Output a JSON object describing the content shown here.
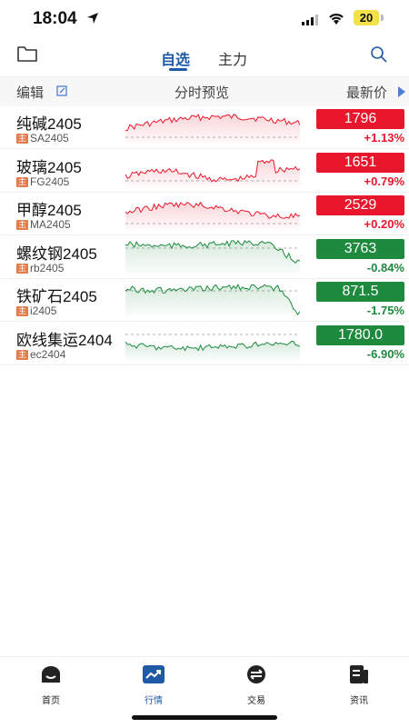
{
  "status": {
    "time": "18:04",
    "battery": "20"
  },
  "tabs": [
    {
      "label": "自选"
    },
    {
      "label": "主力"
    }
  ],
  "header": {
    "edit": "编辑",
    "preview": "分时预览",
    "latest": "最新价"
  },
  "rows": [
    {
      "name": "纯碱2405",
      "badge": "主",
      "code": "SA2405",
      "price": "1796",
      "change": "+1.13%",
      "trend": "up"
    },
    {
      "name": "玻璃2405",
      "badge": "主",
      "code": "FG2405",
      "price": "1651",
      "change": "+0.79%",
      "trend": "up"
    },
    {
      "name": "甲醇2405",
      "badge": "主",
      "code": "MA2405",
      "price": "2529",
      "change": "+0.20%",
      "trend": "up"
    },
    {
      "name": "螺纹钢2405",
      "badge": "主",
      "code": "rb2405",
      "price": "3763",
      "change": "-0.84%",
      "trend": "down"
    },
    {
      "name": "铁矿石2405",
      "badge": "主",
      "code": "i2405",
      "price": "871.5",
      "change": "-1.75%",
      "trend": "down"
    },
    {
      "name": "欧线集运2404",
      "badge": "主",
      "code": "ec2404",
      "price": "1780.0",
      "change": "-6.90%",
      "trend": "down"
    }
  ],
  "nav": [
    {
      "label": "首页"
    },
    {
      "label": "行情"
    },
    {
      "label": "交易"
    },
    {
      "label": "资讯"
    }
  ],
  "colors": {
    "accent": "#1f5aa6",
    "up": "#e8172b",
    "down": "#1d8a3e"
  }
}
